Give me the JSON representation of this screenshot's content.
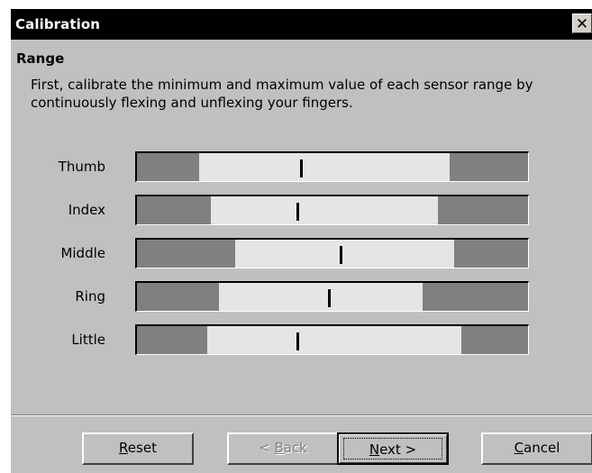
{
  "window": {
    "title": "Calibration",
    "close_glyph": "✕"
  },
  "section": {
    "heading": "Range",
    "description": "First, calibrate the minimum and maximum value of each sensor range by continuously flexing and unflexing your fingers."
  },
  "sensors": [
    {
      "label": "Thumb",
      "min": 0.16,
      "max": 0.8,
      "current": 0.42
    },
    {
      "label": "Index",
      "min": 0.19,
      "max": 0.77,
      "current": 0.41
    },
    {
      "label": "Middle",
      "min": 0.25,
      "max": 0.81,
      "current": 0.52
    },
    {
      "label": "Ring",
      "min": 0.21,
      "max": 0.73,
      "current": 0.49
    },
    {
      "label": "Little",
      "min": 0.18,
      "max": 0.83,
      "current": 0.41
    }
  ],
  "buttons": {
    "reset": {
      "label": "Reset",
      "mnemonic": "R",
      "rest": "eset",
      "enabled": true
    },
    "back": {
      "label": "< Back",
      "prefix": "< ",
      "mnemonic": "B",
      "rest": "ack",
      "enabled": false
    },
    "next": {
      "label": "Next >",
      "mnemonic": "N",
      "rest": "ext >",
      "enabled": true,
      "default": true
    },
    "cancel": {
      "label": "Cancel",
      "mnemonic": "C",
      "rest": "ancel",
      "enabled": true
    }
  },
  "colors": {
    "track_fill": "#e5e5e5",
    "range_out_zone": "#808080",
    "marker": "#000000",
    "titlebar": "#000000",
    "dialog_bg": "#c0c0c0"
  }
}
